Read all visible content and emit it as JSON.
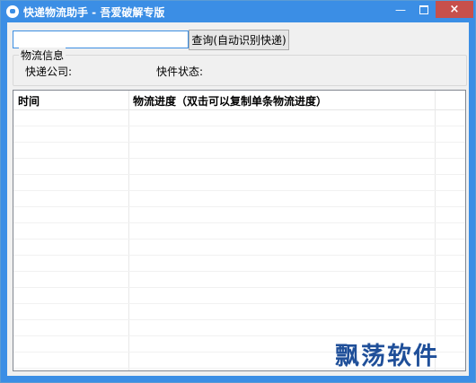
{
  "window": {
    "title": "快递物流助手 - 吾爱破解专版",
    "controls": {
      "minimize": "—",
      "close": "×"
    }
  },
  "search": {
    "value": "",
    "button_label": "查询(自动识别快递)"
  },
  "info_group": {
    "title": "物流信息",
    "company_label": "快递公司:",
    "status_label": "快件状态:"
  },
  "table": {
    "columns": [
      "时间",
      "物流进度（双击可以复制单条物流进度）"
    ],
    "rows": []
  },
  "watermark": "飘荡软件",
  "colors": {
    "titlebar": "#3b8ee5",
    "close_button": "#c7504b",
    "watermark": "#1f4f99"
  }
}
